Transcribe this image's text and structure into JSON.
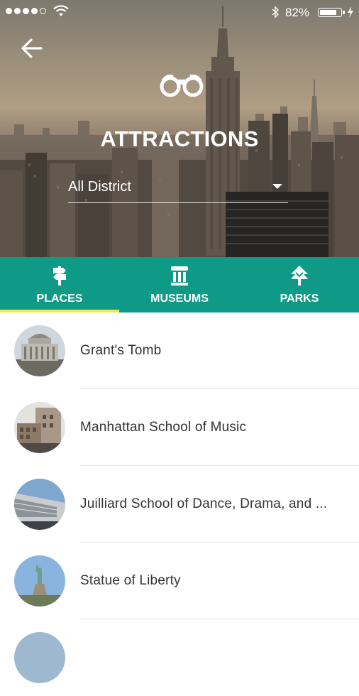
{
  "status_bar": {
    "signal_dots": 5,
    "signal_filled": 4,
    "battery_percent": "82%",
    "battery_level": 0.82
  },
  "header": {
    "title": "ATTRACTIONS",
    "district_select": {
      "selected": "All District"
    },
    "icons": [
      "arrow-left-icon",
      "binoculars-icon"
    ]
  },
  "tabs": [
    {
      "label": "PLACES",
      "icon": "signpost-icon",
      "active": true
    },
    {
      "label": "MUSEUMS",
      "icon": "museum-icon",
      "active": false
    },
    {
      "label": "PARKS",
      "icon": "tree-icon",
      "active": false
    }
  ],
  "places": [
    {
      "name": "Grant's Tomb"
    },
    {
      "name": "Manhattan School of Music"
    },
    {
      "name": "Juilliard School of Dance, Drama, and ..."
    },
    {
      "name": "Statue of Liberty"
    }
  ],
  "colors": {
    "accent": "#0e9a86",
    "tab_indicator": "#f4e64b",
    "text": "#333333",
    "separator": "#e2e2e2"
  }
}
